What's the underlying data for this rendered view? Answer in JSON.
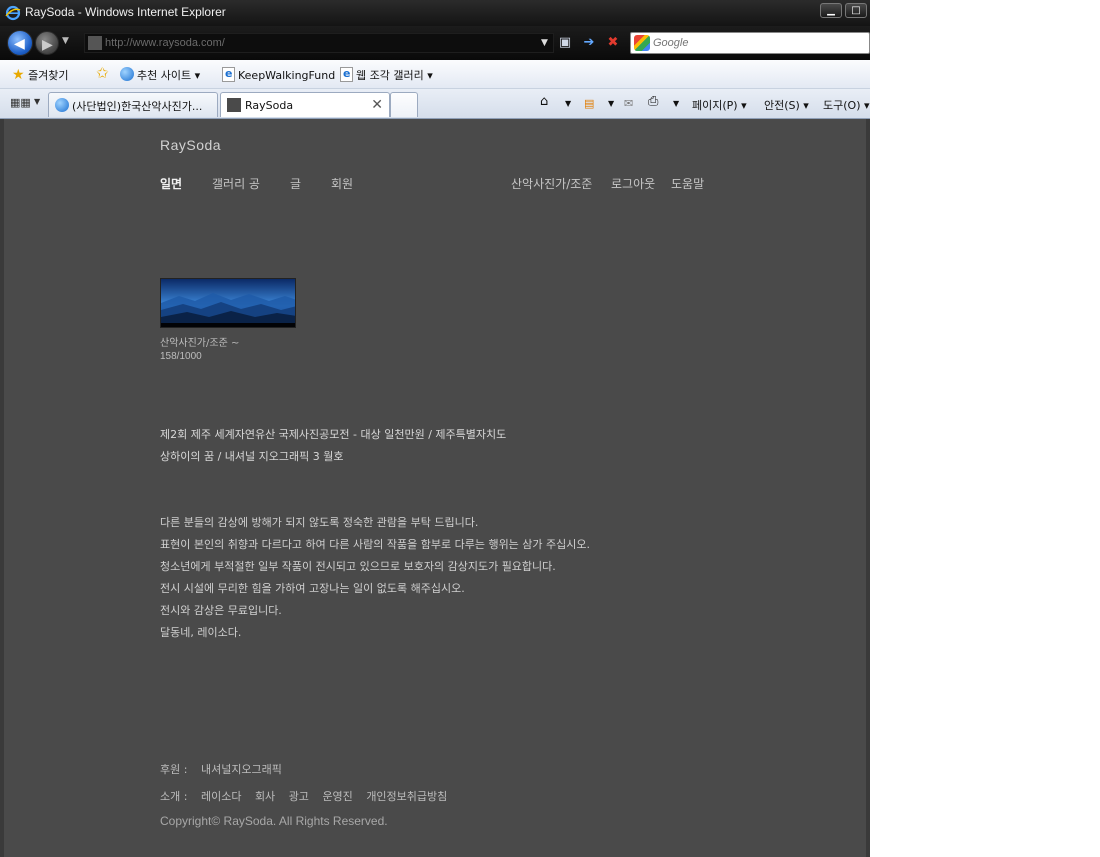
{
  "window": {
    "title": "RaySoda - Windows Internet Explorer",
    "minimize_glyph": "▁",
    "maximize_glyph": "□"
  },
  "address_bar": {
    "url": "http://www.raysoda.com/",
    "search_placeholder": "Google"
  },
  "favorites_bar": {
    "favorites_label": "즐겨찾기",
    "items": [
      {
        "label": "추천 사이트 ▾"
      },
      {
        "label": "KeepWalkingFund"
      },
      {
        "label": "웹 조각 갤러리 ▾"
      }
    ]
  },
  "tabs": {
    "items": [
      {
        "label": "(사단법인)한국산악사진가..."
      },
      {
        "label": "RaySoda"
      }
    ],
    "close_glyph": "✕"
  },
  "command_bar": {
    "page_label": "페이지(P) ▾",
    "safety_label": "안전(S) ▾",
    "tools_label": "도구(O) ▾"
  },
  "site": {
    "brand": "RaySoda",
    "nav_left": [
      "일면",
      "갤러리 공",
      "글",
      "회원"
    ],
    "nav_right": [
      "산악사진가/조준",
      "로그아웃",
      "도움말"
    ],
    "thumbnail": {
      "caption": "산악사진가/조준 ~",
      "count": "158/1000"
    },
    "notices": [
      "제2회 제주 세계자연유산 국제사진공모전 - 대상 일천만원 / 제주특별자치도",
      "상하이의 꿈 / 내셔널 지오그래픽 3 월호"
    ],
    "guidelines": [
      "다른 분들의 감상에 방해가 되지 않도록 정숙한 관람을 부탁 드립니다.",
      "표현이 본인의 취향과 다르다고 하여 다른 사람의 작품을 함부로 다루는 행위는 삼가 주십시오.",
      "청소년에게 부적절한 일부 작품이 전시되고 있으므로 보호자의 감상지도가 필요합니다.",
      "전시 시설에 무리한 힘을 가하여 고장나는 일이 없도록 해주십시오.",
      "전시와 감상은 무료입니다.",
      "달동네, 레이소다."
    ],
    "footer": {
      "sponsor_label": "후원 :",
      "sponsor": "내셔널지오그래픽",
      "about_label": "소개 :",
      "about_links": [
        "레이소다",
        "회사",
        "광고",
        "운영진",
        "개인정보취급방침"
      ],
      "copyright": "Copyright© RaySoda. All Rights Reserved."
    }
  }
}
